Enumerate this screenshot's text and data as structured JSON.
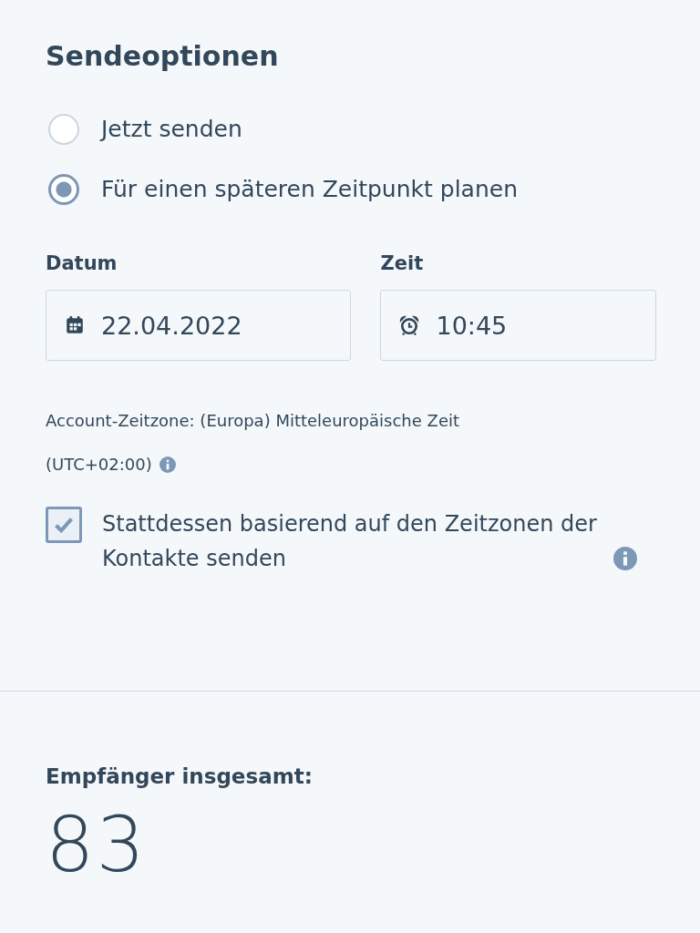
{
  "title": "Sendeoptionen",
  "send_options": [
    {
      "label": "Jetzt senden",
      "selected": false
    },
    {
      "label": "Für einen späteren Zeitpunkt planen",
      "selected": true
    }
  ],
  "date": {
    "label": "Datum",
    "value": "22.04.2022"
  },
  "time": {
    "label": "Zeit",
    "value": "10:45"
  },
  "timezone": {
    "text": "Account-Zeitzone: (Europa) Mitteleuropäische Zeit",
    "utc": "(UTC+02:00)"
  },
  "contact_timezone": {
    "label": "Stattdessen basierend auf den Zeitzonen der Kontakte senden",
    "checked": true
  },
  "recipients": {
    "label": "Empfänger insgesamt:",
    "count": "83"
  }
}
